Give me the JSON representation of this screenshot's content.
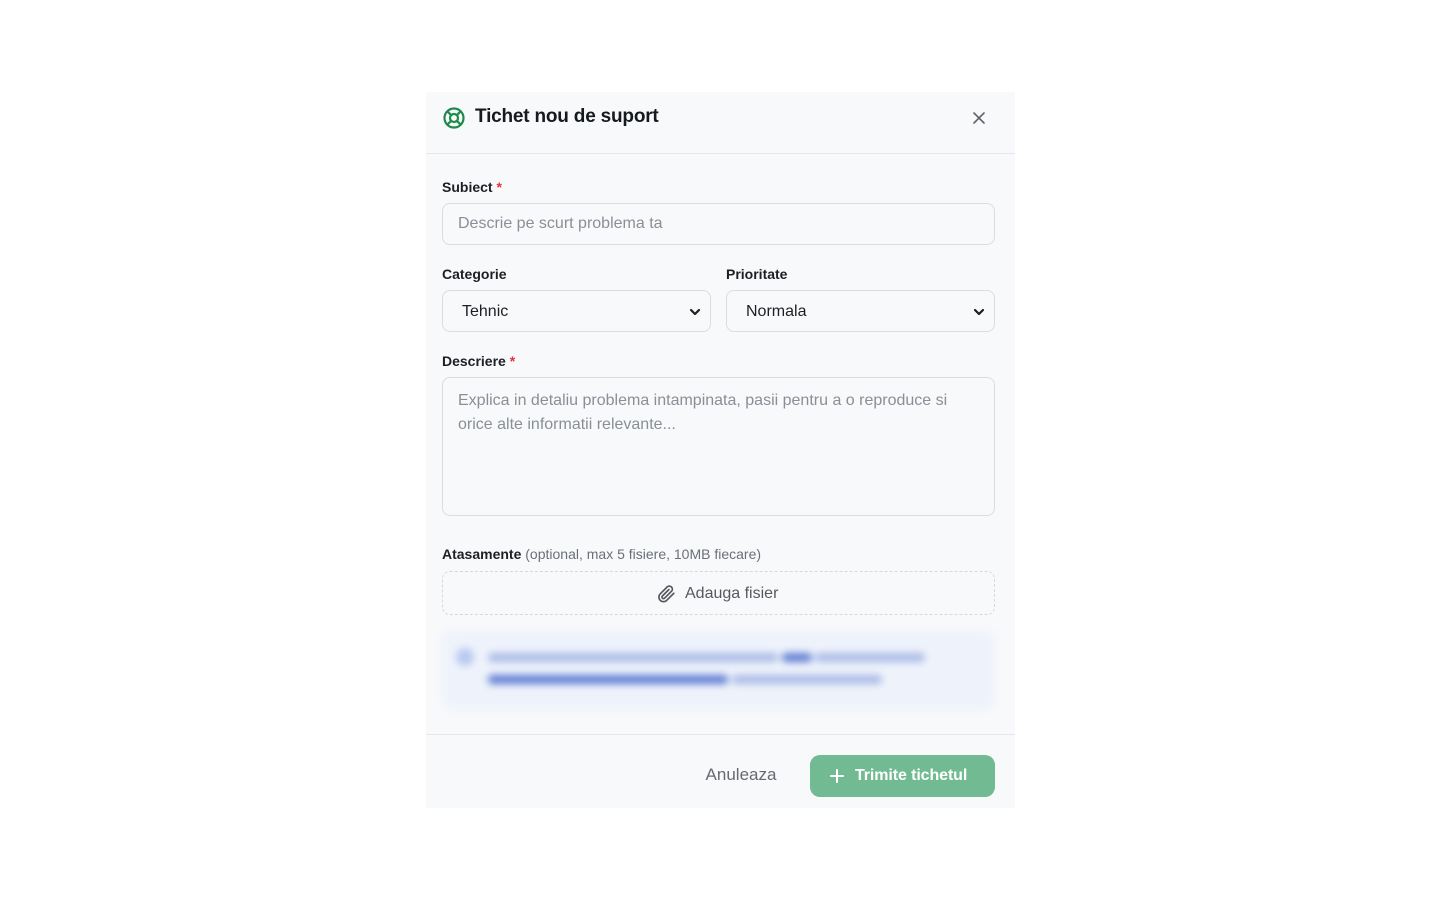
{
  "dialog": {
    "title": "Tichet nou de suport",
    "header_icon": "lifebuoy-icon",
    "close_icon": "close-icon"
  },
  "form": {
    "subject": {
      "label": "Subiect",
      "required_mark": "*",
      "value": "",
      "placeholder": "Descrie pe scurt problema ta"
    },
    "category": {
      "label": "Categorie",
      "selected": "Tehnic"
    },
    "priority": {
      "label": "Prioritate",
      "selected": "Normala"
    },
    "description": {
      "label": "Descriere",
      "required_mark": "*",
      "value": "",
      "placeholder": "Explica in detaliu problema intampinata, pasii pentru a o reproduce si orice alte informatii relevante..."
    },
    "attachments": {
      "label": "Atasamente",
      "hint": "(optional, max 5 fisiere, 10MB fiecare)",
      "add_label": "Adauga fisier",
      "icon": "paperclip-icon"
    }
  },
  "footer": {
    "cancel_label": "Anuleaza",
    "submit_label": "Trimite tichetul",
    "submit_icon": "plus-icon"
  },
  "colors": {
    "accent": "#72bb92",
    "icon_green": "#1f8a4c",
    "required": "#e5323c",
    "notice_bg": "#eef3fb"
  }
}
